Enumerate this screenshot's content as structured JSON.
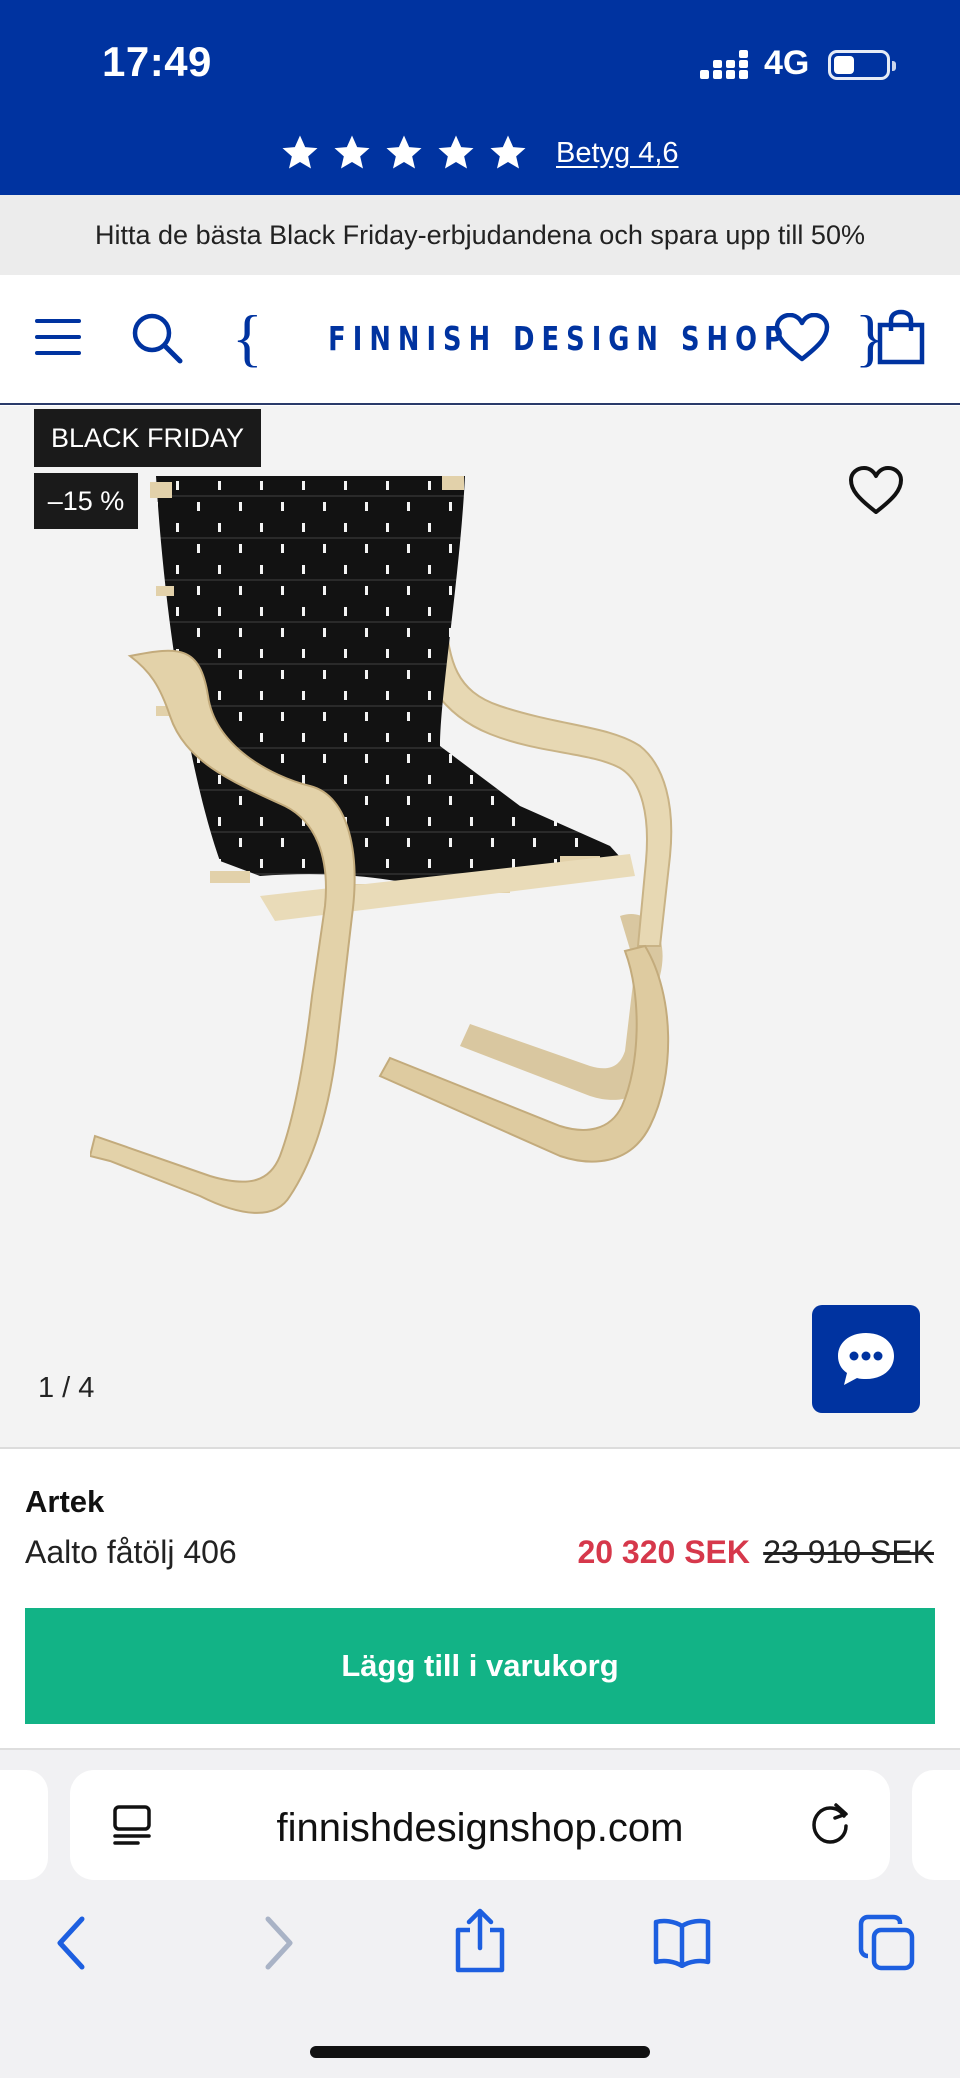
{
  "status_bar": {
    "time": "17:49",
    "network": "4G",
    "battery_percent": 30
  },
  "rating": {
    "stars": 5,
    "label": "Betyg 4,6"
  },
  "promo": {
    "text": "Hitta de bästa Black Friday-erbjudandena och spara upp till 50%"
  },
  "header": {
    "logo_text": "FINNISH DESIGN SHOP",
    "icons": [
      "menu-icon",
      "search-icon",
      "heart-icon",
      "bag-icon"
    ]
  },
  "gallery": {
    "badges": {
      "black_friday": "BLACK FRIDAY",
      "discount": "–15 %"
    },
    "counter": "1 / 4",
    "image": "armchair-photo"
  },
  "product": {
    "brand": "Artek",
    "name": "Aalto fåtölj 406",
    "price": "20 320 SEK",
    "original_price": "23 910 SEK",
    "add_to_cart": "Lägg till i varukorg"
  },
  "browser": {
    "url": "finnishdesignshop.com",
    "nav_icons": [
      "back-icon",
      "forward-icon",
      "share-icon",
      "bookmarks-icon",
      "tabs-icon"
    ]
  },
  "colors": {
    "brand_blue": "#0033a0",
    "cta_green": "#12b386",
    "sale_red": "#d6384b",
    "badge_black": "#1a1a1a"
  }
}
